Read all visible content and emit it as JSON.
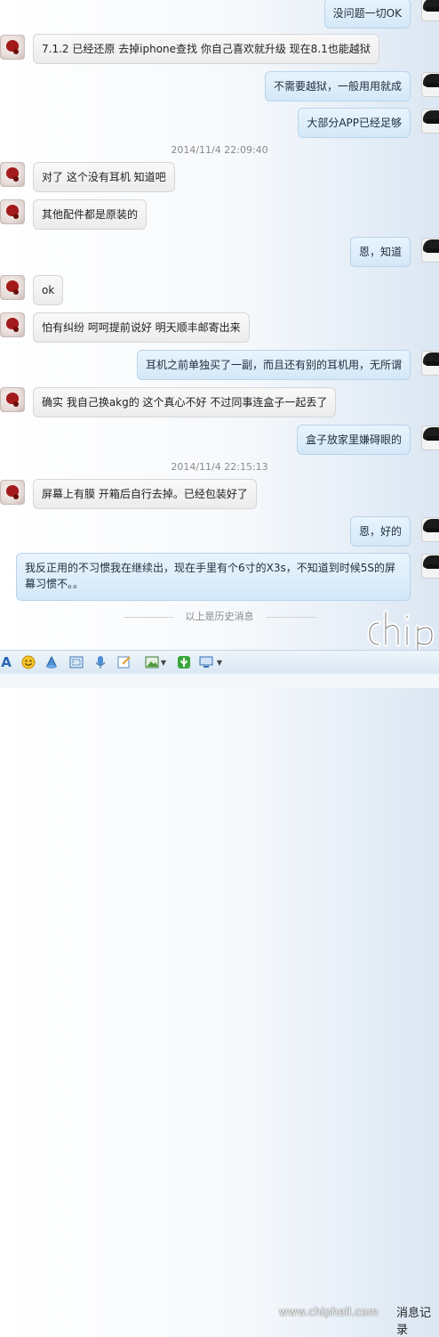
{
  "messages": [
    {
      "side": "right",
      "text": "没问题一切OK"
    },
    {
      "side": "left",
      "text": "7.1.2 已经还原 去掉iphone查找  你自己喜欢就升级 现在8.1也能越狱"
    },
    {
      "side": "right",
      "text": "不需要越狱，一般用用就成"
    },
    {
      "side": "right",
      "text": "大部分APP已经足够"
    },
    {
      "side": "left",
      "text": "对了 这个没有耳机 知道吧"
    },
    {
      "side": "left",
      "text": "其他配件都是原装的"
    },
    {
      "side": "right",
      "text": "恩，知道"
    },
    {
      "side": "left",
      "text": "ok"
    },
    {
      "side": "left",
      "text": "怕有纠纷 呵呵提前说好 明天顺丰邮寄出来"
    },
    {
      "side": "right",
      "text": "耳机之前单独买了一副，而且还有别的耳机用，无所谓"
    },
    {
      "side": "left",
      "text": "确实 我自己换akg的 这个真心不好 不过同事连盒子一起丢了"
    },
    {
      "side": "right",
      "text": "盒子放家里嫌碍眼的"
    },
    {
      "side": "left",
      "text": "屏幕上有膜 开箱后自行去掉。已经包装好了"
    },
    {
      "side": "right",
      "text": "恩，好的"
    },
    {
      "side": "right",
      "text": "我反正用的不习惯我在继续出，现在手里有个6寸的X3s，不知道到时候5S的屏幕习惯不。。"
    }
  ],
  "timestamps": [
    "2014/11/4 22:09:40",
    "2014/11/4 22:15:13"
  ],
  "history_label": "以上是历史消息",
  "toolbar_icons": [
    "font-icon",
    "emoji-icon",
    "shake-icon",
    "screenshot-icon",
    "voice-icon",
    "edit-icon",
    "image-icon",
    "gift-icon",
    "screen-share-icon"
  ],
  "watermark": {
    "logo_text": "chip",
    "url": "www.chiphell.com"
  },
  "clipped_text": "消息记录"
}
